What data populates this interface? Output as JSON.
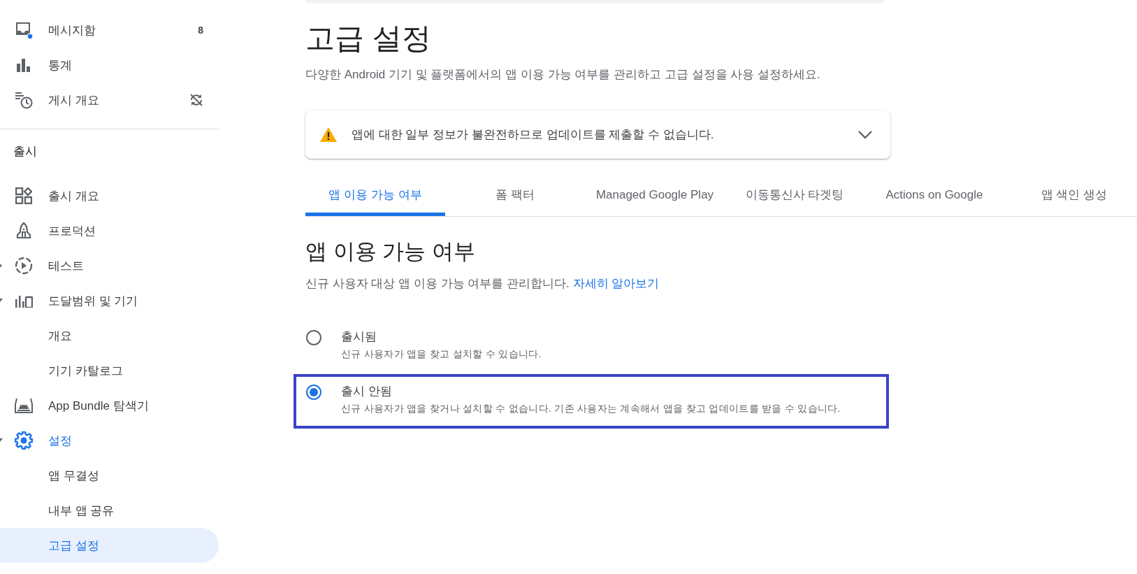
{
  "sidebar": {
    "top_items": [
      {
        "label": "메시지함",
        "badge": "8",
        "selected": false
      },
      {
        "label": "통계",
        "selected": false
      },
      {
        "label": "게시 개요",
        "selected": false
      }
    ],
    "section": {
      "title": "출시",
      "items": [
        {
          "label": "출시 개요",
          "selected": false
        },
        {
          "label": "프로덕션",
          "selected": false
        },
        {
          "label": "테스트",
          "selected": false,
          "expanded": false
        },
        {
          "label": "도달범위 및 기기",
          "selected": false,
          "expanded": true,
          "children": [
            {
              "label": "개요",
              "selected": false
            },
            {
              "label": "기기 카탈로그",
              "selected": false
            }
          ]
        },
        {
          "label": "App Bundle 탐색기",
          "selected": false
        },
        {
          "label": "설정",
          "selected": false,
          "expanded": true,
          "children": [
            {
              "label": "앱 무결성",
              "selected": false
            },
            {
              "label": "내부 앱 공유",
              "selected": false
            },
            {
              "label": "고급 설정",
              "selected": true
            }
          ]
        }
      ]
    }
  },
  "page": {
    "title": "고급 설정",
    "description": "다양한 Android 기기 및 플랫폼에서의 앱 이용 가능 여부를 관리하고 고급 설정을 사용 설정하세요."
  },
  "alert": {
    "message": "앱에 대한 일부 정보가 불완전하므로 업데이트를 제출할 수 없습니다.",
    "expanded": false
  },
  "tabs": [
    {
      "label": "앱 이용 가능 여부",
      "selected": true
    },
    {
      "label": "폼 팩터",
      "selected": false
    },
    {
      "label": "Managed Google Play",
      "selected": false
    },
    {
      "label": "이동통신사 타겟팅",
      "selected": false
    },
    {
      "label": "Actions on Google",
      "selected": false
    },
    {
      "label": "앱 색인 생성",
      "selected": false
    }
  ],
  "section": {
    "title": "앱 이용 가능 여부",
    "description": "신규 사용자 대상 앱 이용 가능 여부를 관리합니다.",
    "link": "자세히 알아보기"
  },
  "options": [
    {
      "label": "출시됨",
      "description": "신규 사용자가 앱을 찾고 설치할 수 있습니다.",
      "selected": false,
      "outlined": false
    },
    {
      "label": "출시 안됨",
      "description": "신규 사용자가 앱을 찾거나 설치할 수 없습니다. 기존 사용자는 계속해서 앱을 찾고 업데이트를 받을 수 있습니다.",
      "selected": true,
      "outlined": true
    }
  ]
}
